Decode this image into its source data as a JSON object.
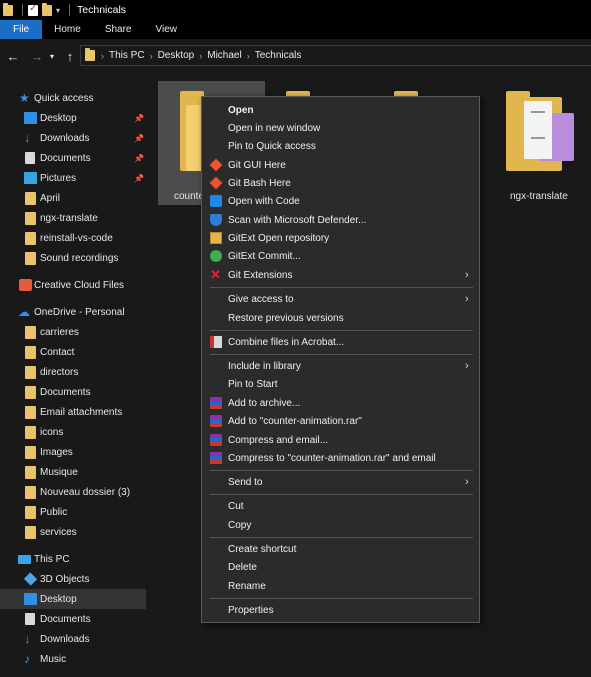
{
  "window": {
    "title": "Technicals"
  },
  "ribbon": {
    "tabs": [
      "File",
      "Home",
      "Share",
      "View"
    ]
  },
  "address": {
    "crumbs": [
      "This PC",
      "Desktop",
      "Michael",
      "Technicals"
    ]
  },
  "sidebar": {
    "items": [
      {
        "label": "Quick access",
        "icon": "star-icon"
      },
      {
        "label": "Desktop",
        "icon": "desktop-icon",
        "pinned": true
      },
      {
        "label": "Downloads",
        "icon": "download-icon",
        "pinned": true
      },
      {
        "label": "Documents",
        "icon": "document-icon",
        "pinned": true
      },
      {
        "label": "Pictures",
        "icon": "pictures-icon",
        "pinned": true
      },
      {
        "label": "April",
        "icon": "folder-icon"
      },
      {
        "label": "ngx-translate",
        "icon": "folder-icon"
      },
      {
        "label": "reinstall-vs-code",
        "icon": "folder-icon"
      },
      {
        "label": "Sound recordings",
        "icon": "folder-icon"
      },
      {
        "label": "Creative Cloud Files",
        "icon": "creative-cloud-icon"
      },
      {
        "label": "OneDrive - Personal",
        "icon": "cloud-icon"
      },
      {
        "label": "carrieres",
        "icon": "folder-icon"
      },
      {
        "label": "Contact",
        "icon": "folder-icon"
      },
      {
        "label": "directors",
        "icon": "folder-icon"
      },
      {
        "label": "Documents",
        "icon": "folder-icon"
      },
      {
        "label": "Email attachments",
        "icon": "folder-icon"
      },
      {
        "label": "icons",
        "icon": "folder-icon"
      },
      {
        "label": "Images",
        "icon": "folder-icon"
      },
      {
        "label": "Musique",
        "icon": "folder-icon"
      },
      {
        "label": "Nouveau dossier (3)",
        "icon": "folder-icon"
      },
      {
        "label": "Public",
        "icon": "folder-icon"
      },
      {
        "label": "services",
        "icon": "folder-icon"
      },
      {
        "label": "This PC",
        "icon": "computer-icon"
      },
      {
        "label": "3D Objects",
        "icon": "3d-objects-icon"
      },
      {
        "label": "Desktop",
        "icon": "desktop-icon",
        "selected": true
      },
      {
        "label": "Documents",
        "icon": "document-icon"
      },
      {
        "label": "Downloads",
        "icon": "download-icon"
      },
      {
        "label": "Music",
        "icon": "music-icon"
      }
    ]
  },
  "content": {
    "tiles": [
      {
        "label": "counte",
        "selected": true
      },
      {
        "label": "ngx-translate"
      }
    ]
  },
  "context_menu": {
    "items": [
      {
        "label": "Open",
        "bold": true
      },
      {
        "label": "Open in new window"
      },
      {
        "label": "Pin to Quick access"
      },
      {
        "label": "Git GUI Here",
        "icon": "git-icon"
      },
      {
        "label": "Git Bash Here",
        "icon": "git-icon"
      },
      {
        "label": "Open with Code",
        "icon": "vscode-icon"
      },
      {
        "label": "Scan with Microsoft Defender...",
        "icon": "defender-shield-icon"
      },
      {
        "label": "GitExt Open repository",
        "icon": "gitext-icon"
      },
      {
        "label": "GitExt Commit...",
        "icon": "gitext-commit-icon"
      },
      {
        "label": "Git Extensions",
        "icon": "git-extensions-icon",
        "submenu": true
      },
      {
        "label": "Give access to",
        "submenu": true
      },
      {
        "label": "Restore previous versions"
      },
      {
        "label": "Combine files in Acrobat...",
        "icon": "acrobat-icon"
      },
      {
        "label": "Include in library",
        "submenu": true
      },
      {
        "label": "Pin to Start"
      },
      {
        "label": "Add to archive...",
        "icon": "winrar-icon"
      },
      {
        "label": "Add to \"counter-animation.rar\"",
        "icon": "winrar-icon"
      },
      {
        "label": "Compress and email...",
        "icon": "winrar-icon"
      },
      {
        "label": "Compress to \"counter-animation.rar\" and email",
        "icon": "winrar-icon"
      },
      {
        "label": "Send to",
        "submenu": true
      },
      {
        "label": "Cut"
      },
      {
        "label": "Copy"
      },
      {
        "label": "Create shortcut"
      },
      {
        "label": "Delete"
      },
      {
        "label": "Rename"
      },
      {
        "label": "Properties"
      }
    ]
  }
}
